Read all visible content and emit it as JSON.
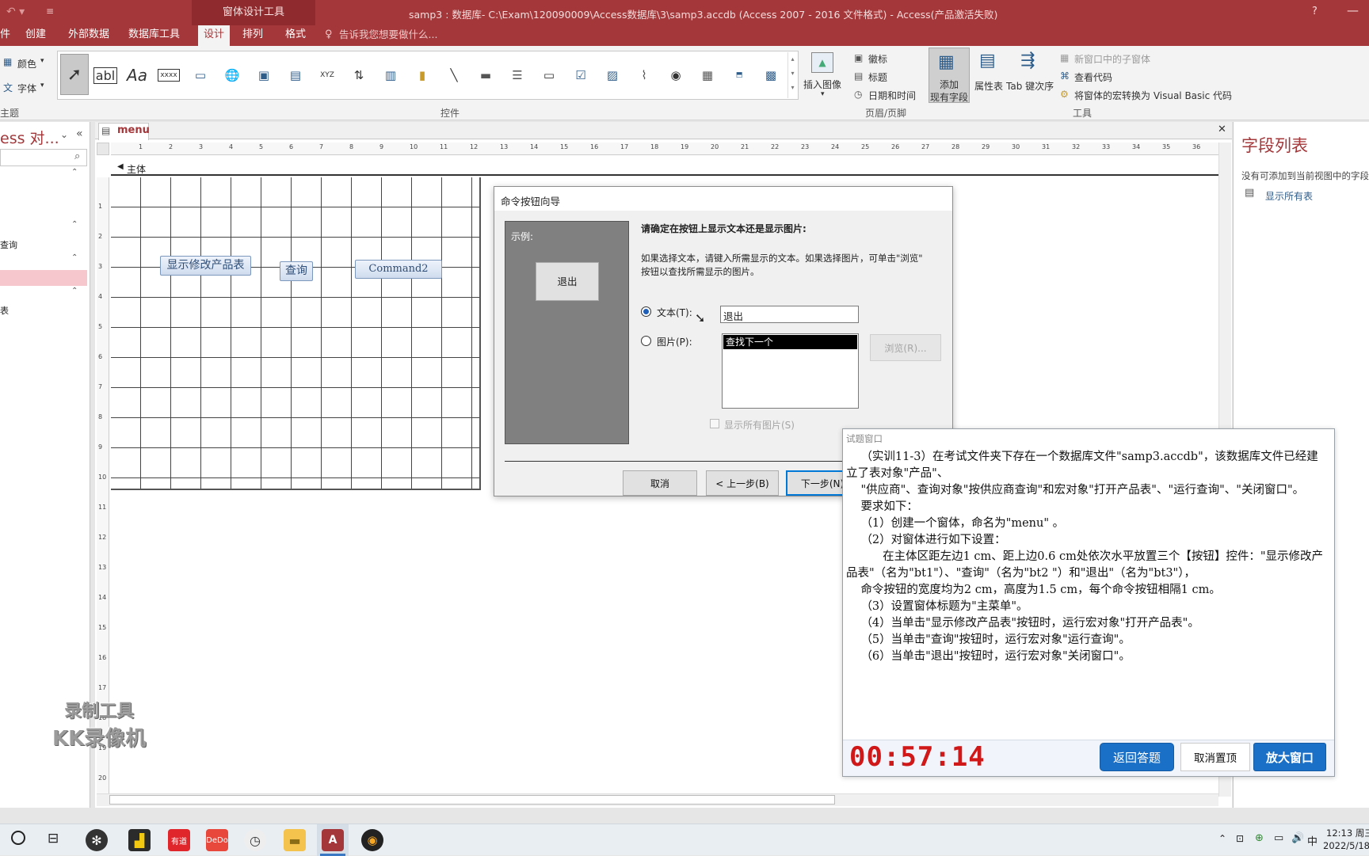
{
  "titlebar": {
    "context_tab": "窗体设计工具",
    "title": "samp3 : 数据库- C:\\Exam\\120090009\\Access数据库\\3\\samp3.accdb (Access 2007 - 2016 文件格式) - Access(产品激活失败)",
    "help": "?"
  },
  "tabs": {
    "partial": "件",
    "create": "创建",
    "external": "外部数据",
    "dbtools": "数据库工具",
    "design": "设计",
    "arrange": "排列",
    "format": "格式",
    "tellme": "告诉我您想要做什么..."
  },
  "ribbon": {
    "color": "颜色",
    "font": "字体",
    "theme_group": "主题",
    "controls_group": "控件",
    "insert_image": "插入图像",
    "logo": "徽标",
    "caption": "标题",
    "datetime": "日期和时间",
    "header_group": "页眉/页脚",
    "add_fields": "添加",
    "add_fields2": "现有字段",
    "property_sheet": "属性表",
    "tab_order": "Tab 键次序",
    "subform": "新窗口中的子窗体",
    "view_code": "查看代码",
    "convert_macros": "将窗体的宏转换为 Visual Basic 代码",
    "tools_group": "工具",
    "ctl_textbox": "abl",
    "ctl_label": "Aa",
    "ctl_button": "xxxx",
    "ctl_combo": "XYZ"
  },
  "nav": {
    "title": "ess 对...",
    "query_item": "查询",
    "table_item": "表"
  },
  "editor": {
    "tab_name": "menu",
    "section": "主体",
    "ruler_left": [
      "1",
      "2",
      "3",
      "4",
      "5",
      "6",
      "7",
      "8",
      "9",
      "10",
      "11",
      "12",
      "13",
      "14",
      "15",
      "16",
      "17",
      "18",
      "19",
      "20"
    ],
    "ruler_top": [
      "1",
      "2",
      "3",
      "4",
      "5",
      "6",
      "7",
      "8",
      "9",
      "10",
      "11",
      "12",
      "13",
      "14",
      "15",
      "16",
      "17",
      "18",
      "19",
      "20",
      "21",
      "22",
      "23",
      "24",
      "25",
      "26",
      "27",
      "28",
      "29",
      "30",
      "31",
      "32",
      "33",
      "34",
      "35",
      "36"
    ],
    "buttons": {
      "b1": "显示修改产品表",
      "b2": "查询",
      "b3": "Command2"
    }
  },
  "watermark": {
    "line1": "录制工具",
    "line2": "KK录像机"
  },
  "fieldlist": {
    "title": "字段列表",
    "message": "没有可添加到当前视图中的字段",
    "show_all": "显示所有表"
  },
  "wizard": {
    "title": "命令按钮向导",
    "sample_label": "示例:",
    "sample_button": "退出",
    "question": "请确定在按钮上显示文本还是显示图片:",
    "desc1": "如果选择文本，请键入所需显示的文本。如果选择图片，可单击\"浏览\"",
    "desc2": "按钮以查找所需显示的图片。",
    "text_option": "文本(T):",
    "text_value": "退出",
    "picture_option": "图片(P):",
    "picture_list": [
      "查找下一个"
    ],
    "browse": "浏览(R)...",
    "show_all_pictures": "显示所有图片(S)",
    "cancel": "取消",
    "back": "< 上一步(B)",
    "next": "下一步(N)"
  },
  "exam": {
    "title": "试题窗口",
    "lines": [
      "    （实训11-3）在考试文件夹下存在一个数据库文件\"samp3.accdb\"，该数据库文件已经建立了表对象\"产品\"、",
      "    \"供应商\"、查询对象\"按供应商查询\"和宏对象\"打开产品表\"、\"运行查询\"、\"关闭窗口\"。",
      "    要求如下：",
      "    （1）创建一个窗体，命名为\"menu\" 。",
      "    （2）对窗体进行如下设置：",
      "          在主体区距左边1 cm、距上边0.6 cm处依次水平放置三个【按钮】控件：\"显示修改产品表\"（名为\"bt1\"）、\"查询\"（名为\"bt2 \"）和\"退出\"（名为\"bt3\"），",
      "    命令按钮的宽度均为2 cm，高度为1.5 cm，每个命令按钮相隔1 cm。",
      "    （3）设置窗体标题为\"主菜单\"。",
      "    （4）当单击\"显示修改产品表\"按钮时，运行宏对象\"打开产品表\"。",
      "    （5）当单击\"查询\"按钮时，运行宏对象\"运行查询\"。",
      "    （6）当单击\"退出\"按钮时，运行宏对象\"关闭窗口\"。"
    ],
    "timer": "00:57:14",
    "return_btn": "返回答题",
    "unpin_btn": "取消置顶",
    "enlarge_btn": "放大窗口"
  },
  "taskbar": {
    "app_youdao": "有道",
    "app_dedao": "DeDo",
    "ime": "中",
    "time": "12:13 周三",
    "date": "2022/5/18"
  }
}
